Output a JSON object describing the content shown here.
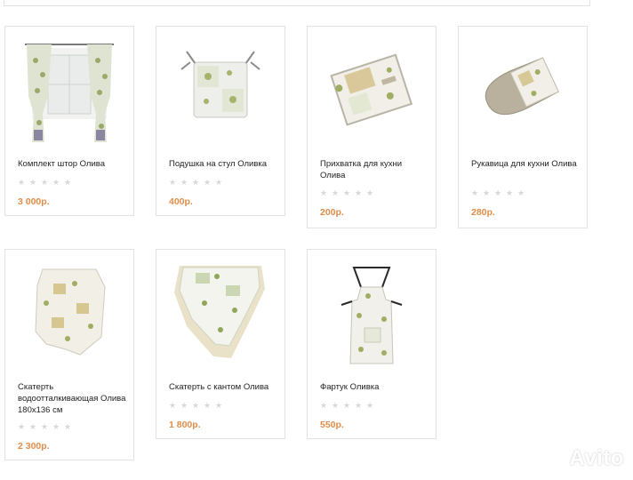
{
  "products": [
    {
      "name": "Комплект штор Олива",
      "price": "3 000р.",
      "rating_stars": 0,
      "image_icon": "curtains-image"
    },
    {
      "name": "Подушка на стул Оливка",
      "price": "400р.",
      "rating_stars": 0,
      "image_icon": "chair-cushion-image"
    },
    {
      "name": "Прихватка для кухни Олива",
      "price": "200р.",
      "rating_stars": 0,
      "image_icon": "potholder-image"
    },
    {
      "name": "Рукавица для кухни Олива",
      "price": "280р.",
      "rating_stars": 0,
      "image_icon": "oven-mitt-image"
    },
    {
      "name": "Скатерть водоотталкивающая Олива 180х136 см",
      "price": "2 300р.",
      "rating_stars": 0,
      "image_icon": "tablecloth-image"
    },
    {
      "name": "Скатерть с кантом Олива",
      "price": "1 800р.",
      "rating_stars": 0,
      "image_icon": "tablecloth-trim-image"
    },
    {
      "name": "Фартук Оливка",
      "price": "550р.",
      "rating_stars": 0,
      "image_icon": "apron-image"
    }
  ],
  "watermark": {
    "text": "Avito"
  },
  "colors": {
    "price": "#e08d4a",
    "star_empty": "#d8d8d8",
    "border": "#e3e3e3"
  }
}
